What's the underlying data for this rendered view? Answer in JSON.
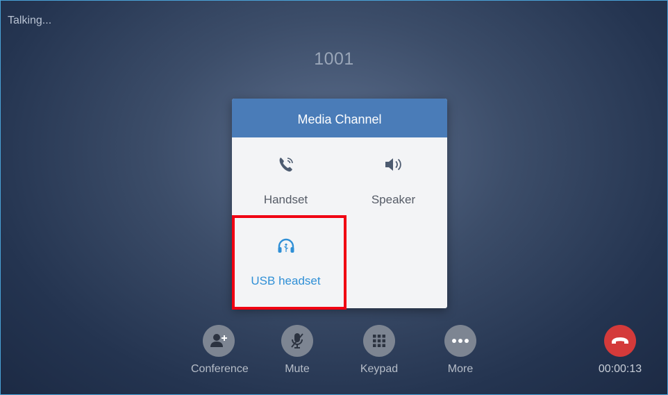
{
  "call": {
    "status": "Talking...",
    "number": "1001",
    "duration": "00:00:13"
  },
  "dialog": {
    "title": "Media Channel",
    "options": [
      {
        "label": "Handset",
        "icon": "handset-icon",
        "selected": false
      },
      {
        "label": "Speaker",
        "icon": "speaker-icon",
        "selected": false
      },
      {
        "label": "USB headset",
        "icon": "usb-headset-icon",
        "selected": true
      }
    ]
  },
  "toolbar": {
    "conference": "Conference",
    "mute": "Mute",
    "keypad": "Keypad",
    "more": "More"
  },
  "colors": {
    "header": "#4a7cb8",
    "selected_text": "#2f8fd6",
    "end_call": "#d43a3a",
    "highlight": "#f00012"
  }
}
